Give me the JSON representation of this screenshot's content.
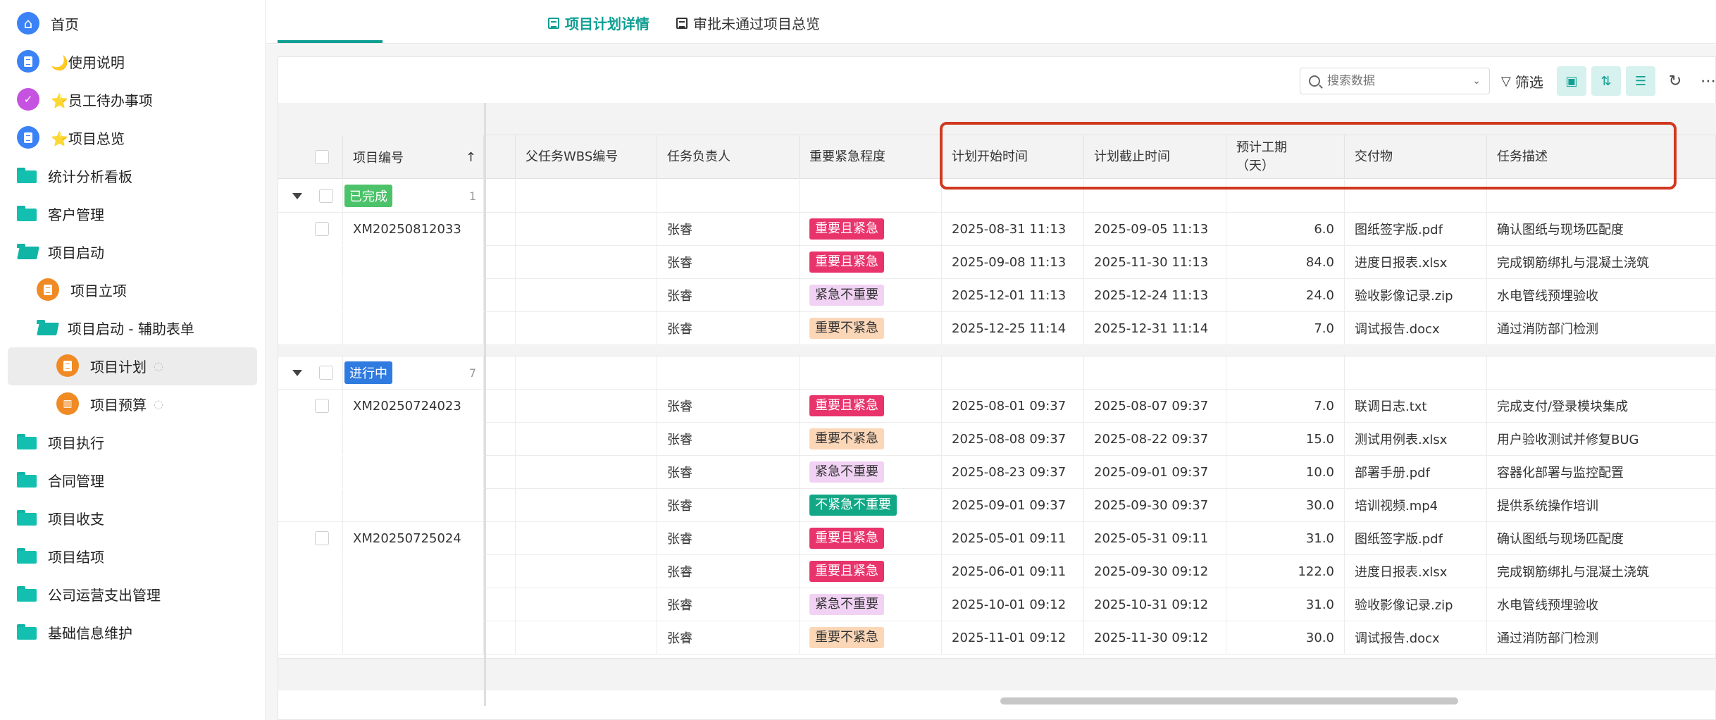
{
  "sidebar": {
    "items": [
      {
        "label": "首页",
        "icon": "home-icon",
        "kind": "blue-circle",
        "indent": 0
      },
      {
        "label": "🌙使用说明",
        "icon": "document-icon",
        "kind": "blue-circle",
        "indent": 0
      },
      {
        "label": "⭐员工待办事项",
        "icon": "todo-icon",
        "kind": "purple-circle",
        "indent": 0
      },
      {
        "label": "⭐项目总览",
        "icon": "document-icon",
        "kind": "blue-circle",
        "indent": 0
      },
      {
        "label": "统计分析看板",
        "icon": "folder-icon",
        "kind": "folder",
        "indent": 0
      },
      {
        "label": "客户管理",
        "icon": "folder-icon",
        "kind": "folder",
        "indent": 0
      },
      {
        "label": "项目启动",
        "icon": "folder-open-icon",
        "kind": "folder-open",
        "indent": 0
      },
      {
        "label": "项目立项",
        "icon": "document-icon",
        "kind": "orange-circle",
        "indent": 1
      },
      {
        "label": "项目启动 - 辅助表单",
        "icon": "folder-open-icon",
        "kind": "folder-open",
        "indent": 1
      },
      {
        "label": "项目计划",
        "icon": "document-icon",
        "kind": "orange-circle",
        "indent": 2,
        "hidden_icon": "eye-slash-icon",
        "active": true
      },
      {
        "label": "项目预算",
        "icon": "budget-icon",
        "kind": "orange-circle",
        "indent": 2,
        "hidden_icon": "eye-slash-icon"
      },
      {
        "label": "项目执行",
        "icon": "folder-icon",
        "kind": "folder",
        "indent": 0
      },
      {
        "label": "合同管理",
        "icon": "folder-icon",
        "kind": "folder",
        "indent": 0
      },
      {
        "label": "项目收支",
        "icon": "folder-icon",
        "kind": "folder",
        "indent": 0
      },
      {
        "label": "项目结项",
        "icon": "folder-icon",
        "kind": "folder",
        "indent": 0
      },
      {
        "label": "公司运营支出管理",
        "icon": "folder-icon",
        "kind": "folder",
        "indent": 0
      },
      {
        "label": "基础信息维护",
        "icon": "folder-icon",
        "kind": "folder",
        "indent": 0
      }
    ]
  },
  "tabs": [
    {
      "label": "项目计划详情",
      "active": true
    },
    {
      "label": "审批未通过项目总览",
      "active": false
    }
  ],
  "toolbar": {
    "search_placeholder": "搜索数据",
    "filter_label": "筛选"
  },
  "table": {
    "frozen_header": "项目编号",
    "sort_icon": "↑",
    "columns": [
      "父任务WBS编号",
      "任务负责人",
      "重要紧急程度",
      "计划开始时间",
      "计划截止时间",
      "预计工期\n（天）",
      "交付物",
      "任务描述"
    ],
    "groups": [
      {
        "label": "已完成",
        "color": "#4cc36a",
        "count": "1",
        "projects": [
          {
            "code": "XM20250812033",
            "tasks": [
              {
                "owner": "张睿",
                "priority": "重要且紧急",
                "start": "2025-08-31 11:13",
                "end": "2025-09-05 11:13",
                "days": "6.0",
                "deliverable": "图纸签字版.pdf",
                "desc": "确认图纸与现场匹配度"
              },
              {
                "owner": "张睿",
                "priority": "重要且紧急",
                "start": "2025-09-08 11:13",
                "end": "2025-11-30 11:13",
                "days": "84.0",
                "deliverable": "进度日报表.xlsx",
                "desc": "完成钢筋绑扎与混凝土浇筑"
              },
              {
                "owner": "张睿",
                "priority": "紧急不重要",
                "start": "2025-12-01 11:13",
                "end": "2025-12-24 11:13",
                "days": "24.0",
                "deliverable": "验收影像记录.zip",
                "desc": "水电管线预埋验收"
              },
              {
                "owner": "张睿",
                "priority": "重要不紧急",
                "start": "2025-12-25 11:14",
                "end": "2025-12-31 11:14",
                "days": "7.0",
                "deliverable": "调试报告.docx",
                "desc": "通过消防部门检测"
              }
            ]
          }
        ]
      },
      {
        "label": "进行中",
        "color": "#2f7be0",
        "count": "7",
        "projects": [
          {
            "code": "XM20250724023",
            "tasks": [
              {
                "owner": "张睿",
                "priority": "重要且紧急",
                "start": "2025-08-01 09:37",
                "end": "2025-08-07 09:37",
                "days": "7.0",
                "deliverable": "联调日志.txt",
                "desc": "完成支付/登录模块集成"
              },
              {
                "owner": "张睿",
                "priority": "重要不紧急",
                "start": "2025-08-08 09:37",
                "end": "2025-08-22 09:37",
                "days": "15.0",
                "deliverable": "测试用例表.xlsx",
                "desc": "用户验收测试并修复BUG"
              },
              {
                "owner": "张睿",
                "priority": "紧急不重要",
                "start": "2025-08-23 09:37",
                "end": "2025-09-01 09:37",
                "days": "10.0",
                "deliverable": "部署手册.pdf",
                "desc": "容器化部署与监控配置"
              },
              {
                "owner": "张睿",
                "priority": "不紧急不重要",
                "start": "2025-09-01 09:37",
                "end": "2025-09-30 09:37",
                "days": "30.0",
                "deliverable": "培训视频.mp4",
                "desc": "提供系统操作培训"
              }
            ]
          },
          {
            "code": "XM20250725024",
            "tasks": [
              {
                "owner": "张睿",
                "priority": "重要且紧急",
                "start": "2025-05-01 09:11",
                "end": "2025-05-31 09:11",
                "days": "31.0",
                "deliverable": "图纸签字版.pdf",
                "desc": "确认图纸与现场匹配度"
              },
              {
                "owner": "张睿",
                "priority": "重要且紧急",
                "start": "2025-06-01 09:11",
                "end": "2025-09-30 09:12",
                "days": "122.0",
                "deliverable": "进度日报表.xlsx",
                "desc": "完成钢筋绑扎与混凝土浇筑"
              },
              {
                "owner": "张睿",
                "priority": "紧急不重要",
                "start": "2025-10-01 09:12",
                "end": "2025-10-31 09:12",
                "days": "31.0",
                "deliverable": "验收影像记录.zip",
                "desc": "水电管线预埋验收"
              },
              {
                "owner": "张睿",
                "priority": "重要不紧急",
                "start": "2025-11-01 09:12",
                "end": "2025-11-30 09:12",
                "days": "30.0",
                "deliverable": "调试报告.docx",
                "desc": "通过消防部门检测"
              }
            ]
          }
        ]
      }
    ]
  },
  "priority_colors": {
    "重要且紧急": {
      "bg": "#e8336b",
      "fg": "#ffffff"
    },
    "紧急不重要": {
      "bg": "#f1d2f4",
      "fg": "#333333"
    },
    "重要不紧急": {
      "bg": "#fbd7b8",
      "fg": "#333333"
    },
    "不紧急不重要": {
      "bg": "#12a886",
      "fg": "#ffffff"
    }
  },
  "colors": {
    "accent": "#0f9f93",
    "highlight_box": "#d0391f"
  }
}
